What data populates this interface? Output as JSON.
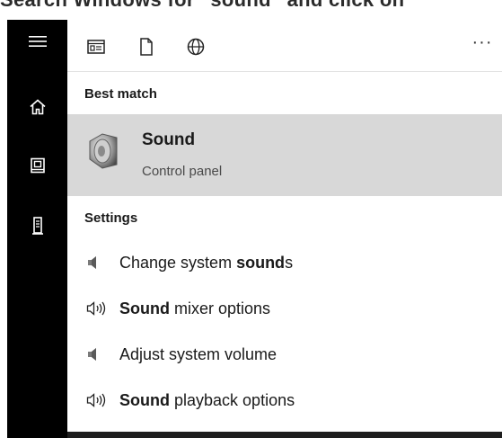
{
  "caption": {
    "text": "Search Windows for “sound” and click on"
  },
  "sidebar": {
    "items": [
      {
        "icon": "hamburger-icon"
      },
      {
        "icon": "home-icon"
      },
      {
        "icon": "notebook-icon"
      },
      {
        "icon": "tower-icon"
      }
    ]
  },
  "toolbar": {
    "filters": [
      {
        "icon": "apps-filter-icon"
      },
      {
        "icon": "documents-filter-icon"
      },
      {
        "icon": "web-filter-icon"
      }
    ],
    "more_label": "···"
  },
  "best_match": {
    "heading": "Best match",
    "title": "Sound",
    "subtitle": "Control panel",
    "icon": "speaker-icon",
    "highlight_color": "#d8d8d8"
  },
  "settings": {
    "heading": "Settings",
    "items": [
      {
        "icon": "speaker-small-icon",
        "pre": "Change system ",
        "bold": "sound",
        "post": "s"
      },
      {
        "icon": "speaker-waves-icon",
        "pre": "",
        "bold": "Sound",
        "post": " mixer options"
      },
      {
        "icon": "speaker-small-icon",
        "pre": "Adjust system volume",
        "bold": "",
        "post": ""
      },
      {
        "icon": "speaker-waves-icon",
        "pre": "",
        "bold": "Sound",
        "post": " playback options"
      }
    ]
  }
}
